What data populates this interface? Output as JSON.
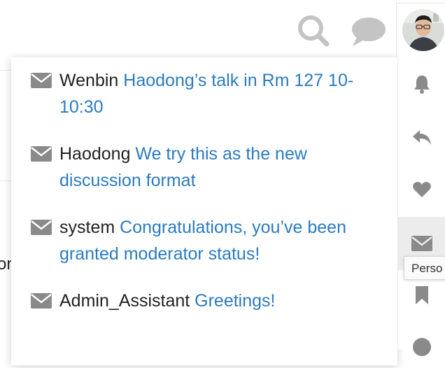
{
  "header": {
    "icons": [
      "search-icon",
      "chat-icon"
    ],
    "avatar_icon": "user-avatar"
  },
  "background": {
    "partial_text": "on"
  },
  "messages": [
    {
      "sender": "Wenbin",
      "subject": "Haodong’s talk in Rm 127 10-10:30"
    },
    {
      "sender": "Haodong",
      "subject": "We try this as the new discussion format"
    },
    {
      "sender": "system",
      "subject": "Congratulations, you’ve been granted moderator status!"
    },
    {
      "sender": "Admin_Assistant",
      "subject": "Greetings!"
    }
  ],
  "rail": {
    "icons": [
      "bell-icon",
      "reply-icon",
      "heart-icon",
      "envelope-icon",
      "bookmark-icon",
      "user-icon"
    ],
    "active": "envelope-icon",
    "tooltip": "Perso"
  },
  "colors": {
    "link": "#2b7bbf",
    "icon_gray": "#8a8a8a",
    "active_bg": "#ececec"
  }
}
